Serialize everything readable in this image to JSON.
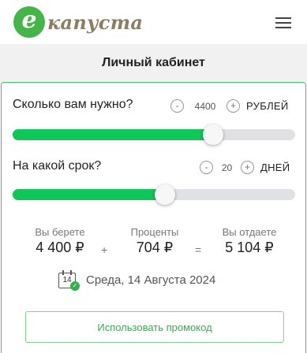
{
  "header": {
    "logo_letter": "е",
    "logo_text": "капуста",
    "brand_color": "#45b549",
    "menu_icon": "hamburger-menu-icon"
  },
  "subheader": {
    "title": "Личный кабинет"
  },
  "calculator": {
    "amount": {
      "label": "Сколько вам нужно?",
      "minus": "-",
      "value": "4400",
      "plus": "+",
      "unit": "РУБЛЕЙ",
      "slider_fraction": 0.71
    },
    "term": {
      "label": "На какой срок?",
      "minus": "-",
      "value": "20",
      "plus": "+",
      "unit": "ДНЕЙ",
      "slider_fraction": 0.54
    },
    "slider_fill_color": "#0fc659",
    "summary": {
      "borrow_caption": "Вы берете",
      "borrow_value": "4 400 ₽",
      "plus_sign": "+",
      "interest_caption": "Проценты",
      "interest_value": "704 ₽",
      "equals_sign": "=",
      "return_caption": "Вы отдаете",
      "return_value": "5 104 ₽"
    },
    "due": {
      "calendar_day": "14",
      "calendar_icon": "calendar-check-icon",
      "date_text": "Среда, 14 Августа 2024"
    },
    "promo_button": "Использовать промокод"
  }
}
